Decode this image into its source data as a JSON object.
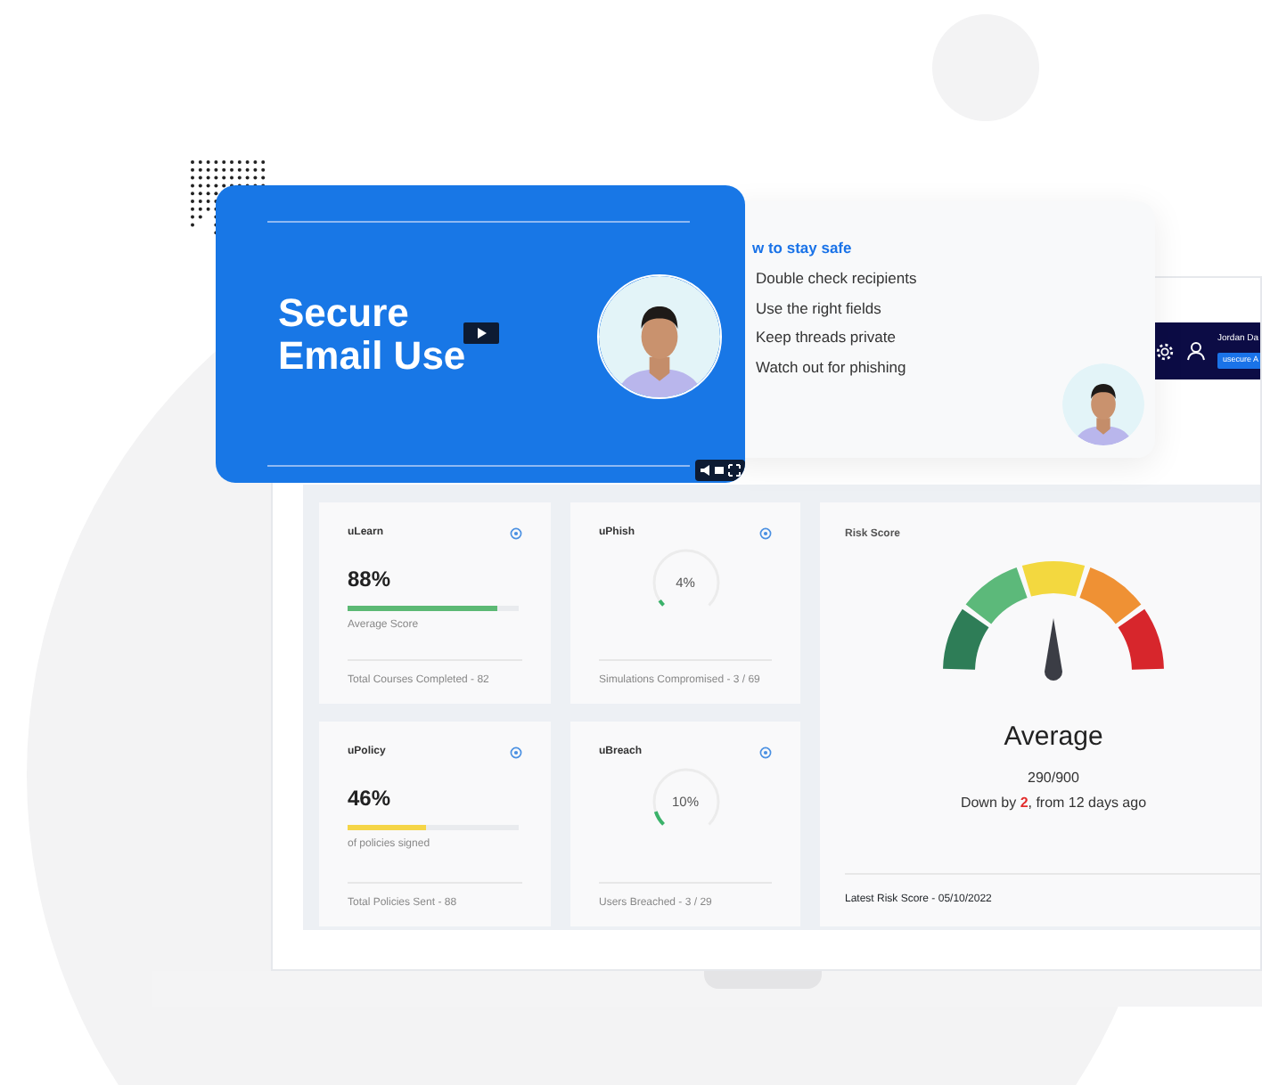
{
  "video": {
    "title_lines": [
      "Secure",
      "Email Use"
    ],
    "kind": "picture"
  },
  "tips": {
    "heading": "w to stay safe",
    "items": [
      "Double check recipients",
      "Use the right fields",
      "Keep threads private",
      "Watch out for phishing"
    ]
  },
  "header": {
    "user_name": "Jordan Da",
    "role_badge": "usecure A"
  },
  "cards": [
    {
      "kind": "bar",
      "title": "uLearn",
      "value": "88%",
      "level": 0.88,
      "color": "#5cb974",
      "caption": "Average Score",
      "footer": "Total Courses Completed - 82"
    },
    {
      "kind": "ring",
      "title": "uPhish",
      "value": "4%",
      "level": 0.04,
      "footer": "Simulations Compromised - 3 / 69"
    },
    {
      "kind": "bar",
      "title": "uPolicy",
      "value": "46%",
      "level": 0.46,
      "color": "#f5d547",
      "caption": "of policies signed",
      "footer": "Total Policies Sent - 88"
    },
    {
      "kind": "ring",
      "title": "uBreach",
      "value": "10%",
      "level": 0.1,
      "footer": "Users Breached - 3 / 29"
    }
  ],
  "risk": {
    "title": "Risk Score",
    "level": 0.5,
    "rating": "Average",
    "score": "290/900",
    "change": "Down by **2**, from 12 days ago",
    "footer": "Latest Risk Score - 05/10/2022"
  }
}
